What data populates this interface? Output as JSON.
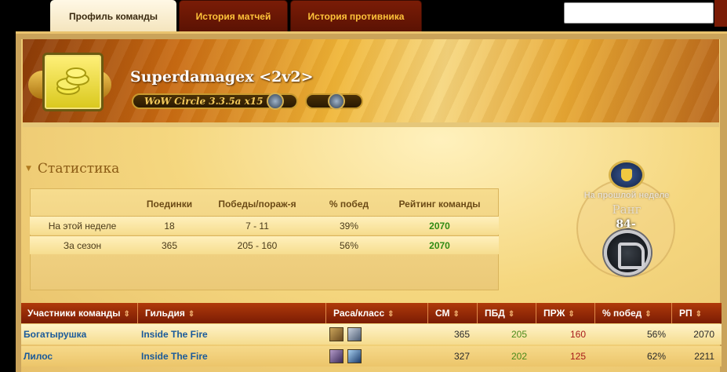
{
  "tabs": [
    {
      "label": "Профиль команды",
      "active": true
    },
    {
      "label": "История матчей",
      "active": false
    },
    {
      "label": "История противника",
      "active": false
    }
  ],
  "search": {
    "value": ""
  },
  "team": {
    "name": "Superdamagex <2v2>",
    "realm": "WoW Circle 3.3.5a x15",
    "emblem_icon": "gold-coins-icon",
    "faction_icon": "alliance-icon"
  },
  "stats": {
    "title": "Статистика",
    "headers": [
      "Поединки",
      "Победы/пораж-я",
      "% побед",
      "Рейтинг команды"
    ],
    "rows": [
      {
        "label": "На этой неделе",
        "games": "18",
        "wl": "7 - 11",
        "pct": "39%",
        "rating": "2070"
      },
      {
        "label": "За сезон",
        "games": "365",
        "wl": "205 - 160",
        "pct": "56%",
        "rating": "2070"
      }
    ]
  },
  "rank": {
    "label": "На прошлой неделе",
    "title": "Ранг",
    "value": "84-"
  },
  "members": {
    "headers": [
      "Участники команды",
      "Гильдия",
      "Раса/класс",
      "СМ",
      "ПБД",
      "ПРЖ",
      "% побед",
      "РП"
    ],
    "sort_glyph": "⇕",
    "rows": [
      {
        "name": "Богатырушка",
        "guild": "Inside The Fire",
        "race_icon": "human-icon",
        "class_icon": "warrior-icon",
        "games": "365",
        "wins": "205",
        "losses": "160",
        "pct": "56%",
        "rating": "2070"
      },
      {
        "name": "Лилос",
        "guild": "Inside The Fire",
        "race_icon": "undead-icon",
        "class_icon": "mage-icon",
        "games": "327",
        "wins": "202",
        "losses": "125",
        "pct": "62%",
        "rating": "2211"
      }
    ]
  },
  "colors": {
    "accent": "#7a1c06",
    "link": "#1a5a9a",
    "win": "#2f8a12",
    "loss": "#a81a1a"
  }
}
